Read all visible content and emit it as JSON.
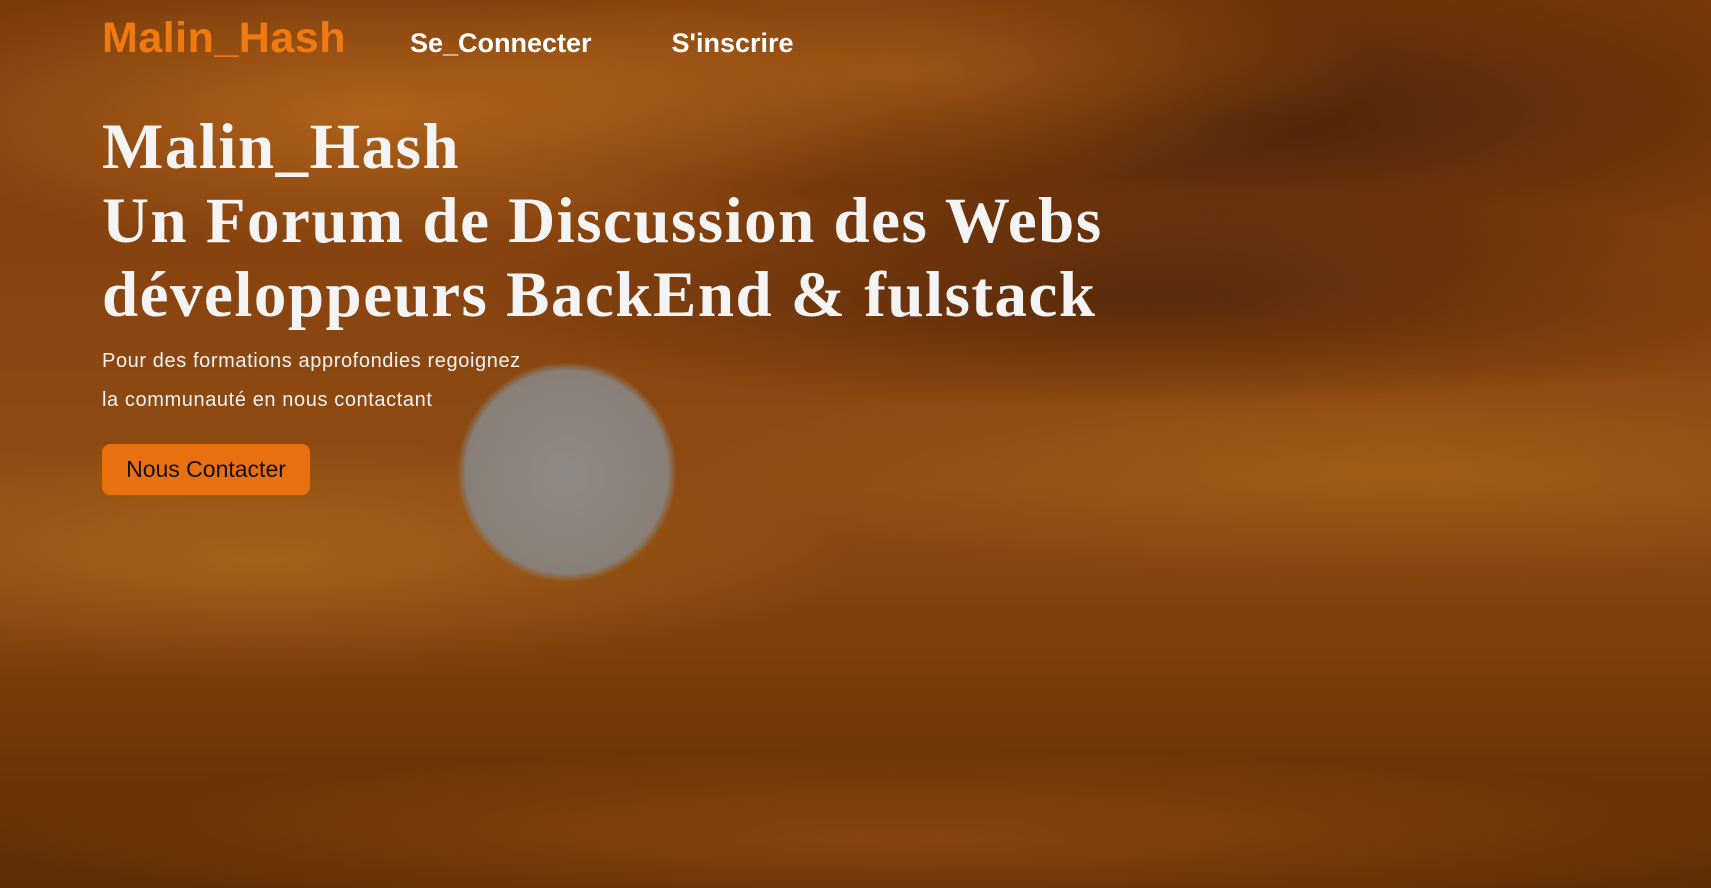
{
  "nav": {
    "brand": "Malin_Hash",
    "links": [
      {
        "label": "Se_Connecter"
      },
      {
        "label": "S'inscrire"
      }
    ]
  },
  "hero": {
    "title_lines": [
      "Malin_Hash",
      "Un Forum de Discussion des Webs",
      "développeurs BackEnd & fulstack"
    ],
    "subtitle_lines": [
      "Pour des formations approfondies regoignez",
      "la communauté en nous contactant"
    ],
    "cta_label": "Nous Contacter"
  },
  "colors": {
    "brand": "#f07a10",
    "cta_background": "#e8700f",
    "text": "#ffffff"
  },
  "background_image": "sunset-clouds"
}
